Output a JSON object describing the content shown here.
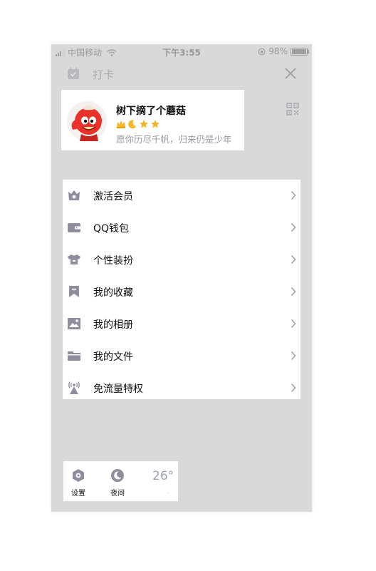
{
  "status_bar": {
    "carrier": "中国移动",
    "time": "下午3:55",
    "battery": "98%",
    "battery_level": 0.98
  },
  "topbar": {
    "checkin_label": "打卡",
    "checkin_icon": "calendar-icon",
    "close_icon": "close-icon"
  },
  "profile": {
    "nickname": "树下摘了个蘑菇",
    "signature": "愿你历尽千帆，归来仍是少年",
    "badges": [
      "crown-icon",
      "moon-icon",
      "star-icon",
      "star-icon"
    ],
    "qr_icon": "qr-code-icon"
  },
  "menu": {
    "items": [
      {
        "label": "激活会员",
        "icon": "member-icon"
      },
      {
        "label": "QQ钱包",
        "icon": "wallet-icon"
      },
      {
        "label": "个性装扮",
        "icon": "shirt-icon"
      },
      {
        "label": "我的收藏",
        "icon": "bookmark-icon"
      },
      {
        "label": "我的相册",
        "icon": "photo-icon"
      },
      {
        "label": "我的文件",
        "icon": "folder-icon"
      },
      {
        "label": "免流量特权",
        "icon": "antenna-icon"
      }
    ]
  },
  "bottom": {
    "settings_label": "设置",
    "night_label": "夜间",
    "temperature": "26°"
  },
  "colors": {
    "icon_gray": "#8e8e9e",
    "overlay": "#d9d9d9",
    "card": "#ffffff",
    "avatar_red": "#e8322b",
    "badge_gold": "#f3b72c"
  }
}
